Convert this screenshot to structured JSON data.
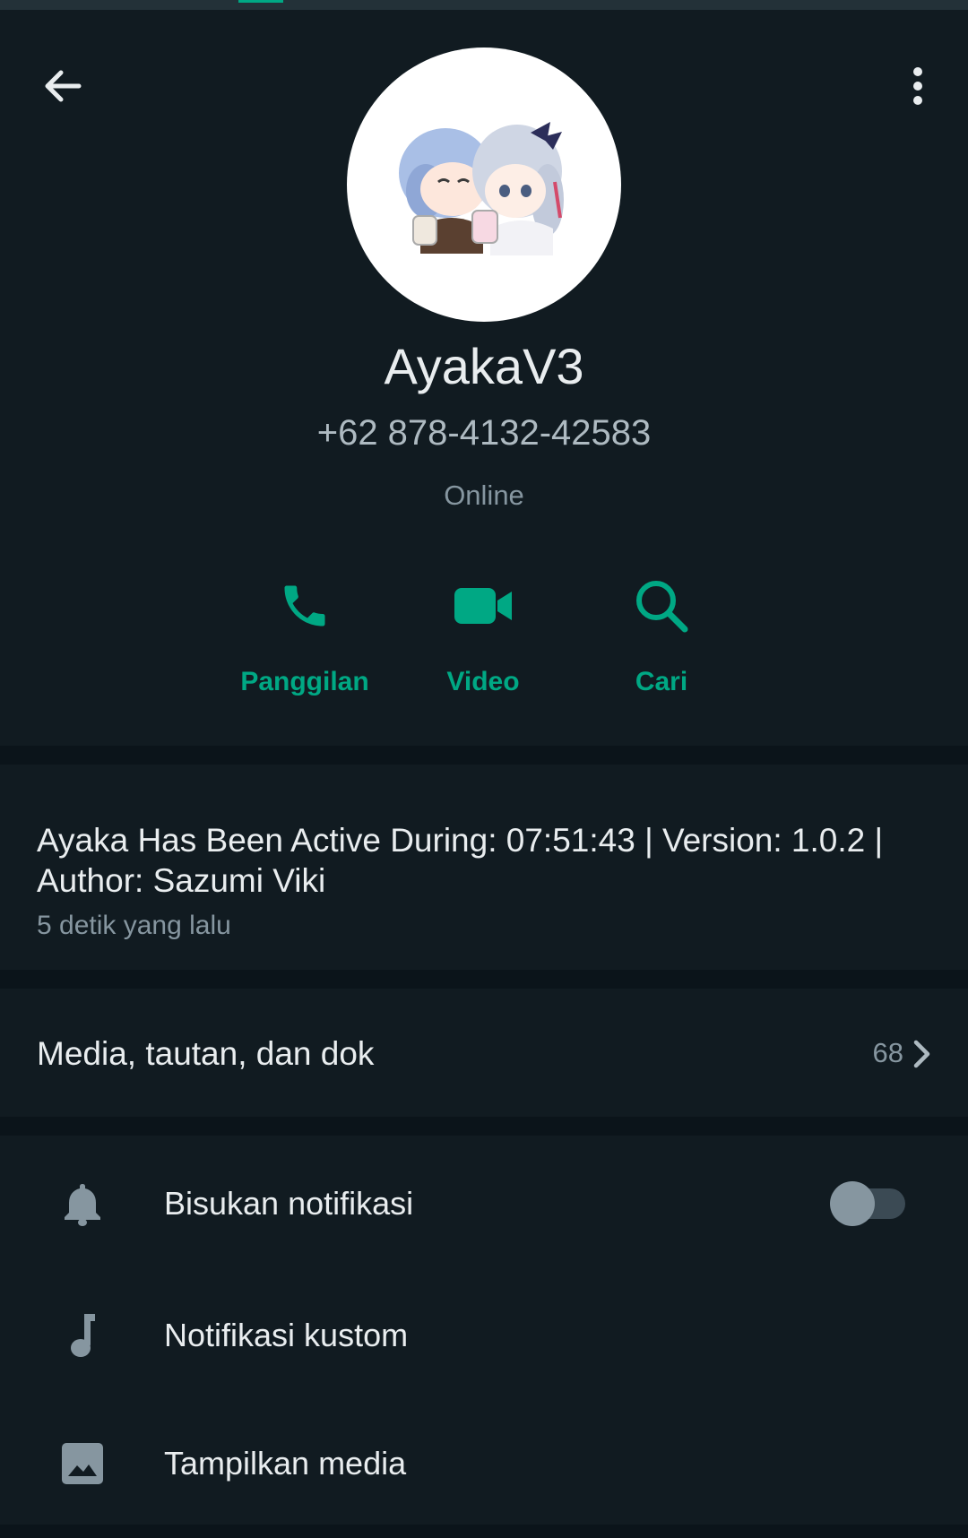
{
  "colors": {
    "background": "#0b141a",
    "panel": "#111b21",
    "accent": "#00a884",
    "primary_text": "#e9edef",
    "secondary_text": "#8696a0"
  },
  "header": {
    "back_icon": "arrow-left-icon",
    "menu_icon": "more-vertical-icon"
  },
  "profile": {
    "name": "AyakaV3",
    "phone": "+62 878-4132-42583",
    "status": "Online"
  },
  "actions": [
    {
      "icon": "phone-icon",
      "label": "Panggilan"
    },
    {
      "icon": "video-camera-icon",
      "label": "Video"
    },
    {
      "icon": "search-icon",
      "label": "Cari"
    }
  ],
  "about": {
    "text": "Ayaka Has Been Active During: 07:51:43 | Version: 1.0.2 | Author: Sazumi Viki",
    "time": "5 detik yang lalu"
  },
  "media": {
    "label": "Media, tautan, dan dok",
    "count": "68"
  },
  "settings": {
    "items": [
      {
        "icon": "bell-icon",
        "label": "Bisukan notifikasi",
        "toggle": false
      },
      {
        "icon": "music-note-icon",
        "label": "Notifikasi kustom"
      },
      {
        "icon": "image-icon",
        "label": "Tampilkan media"
      }
    ]
  }
}
